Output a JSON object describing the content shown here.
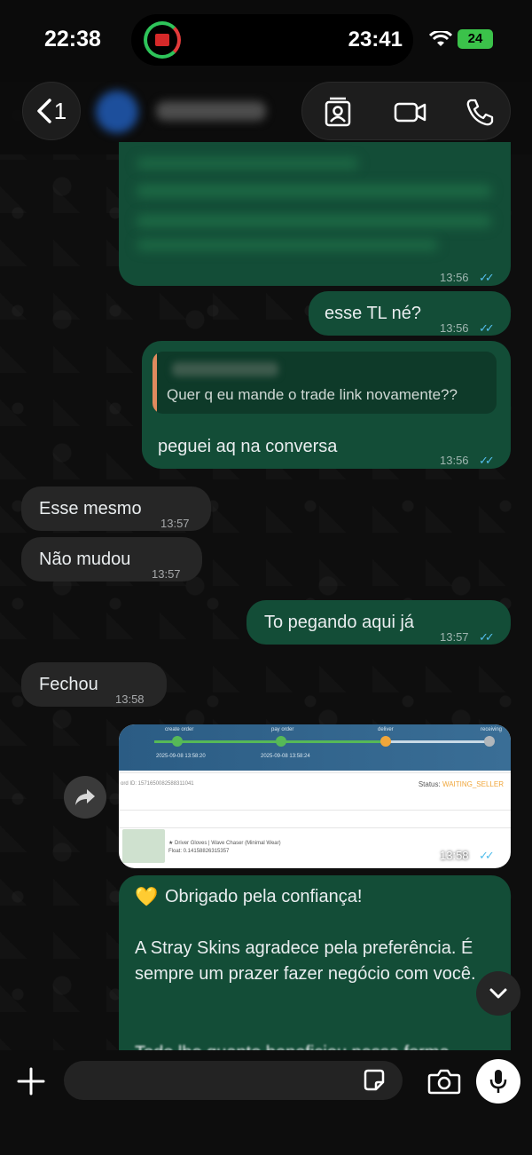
{
  "status_bar": {
    "time_left": "22:38",
    "island_time": "23:41",
    "battery": "24"
  },
  "header": {
    "back_count": "1",
    "icons": [
      "contact-card-icon",
      "video-call-icon",
      "phone-icon"
    ]
  },
  "messages": {
    "m1": {
      "time": "13:56"
    },
    "m2": {
      "text": "esse TL né?",
      "time": "13:56"
    },
    "m3": {
      "quote": "Quer q eu mande o trade link novamente??",
      "text": "peguei aq na conversa",
      "time": "13:56"
    },
    "m4": {
      "text": "Esse mesmo",
      "time": "13:57"
    },
    "m5": {
      "text": "Não mudou",
      "time": "13:57"
    },
    "m6": {
      "text": "To pegando aqui já",
      "time": "13:57"
    },
    "m7": {
      "text": "Fechou",
      "time": "13:58"
    },
    "m8": {
      "time": "13:58",
      "screenshot": {
        "steps": [
          "create order",
          "pay order",
          "deliver",
          "receiving"
        ],
        "dates": [
          "2025-09-08 13:58:20",
          "2025-09-08 13:58:24"
        ],
        "order_id": "ord ID: 1571650082588311041",
        "status_label": "Status: ",
        "status_value": "WAITING_SELLER",
        "item_name": "★ Driver Gloves | Wave Chaser (Minimal Wear)",
        "item_float": "Float: 0.14158826315357"
      }
    },
    "m9": {
      "heart": "💛",
      "line1": "Obrigado pela confiança!",
      "line2": "A Stray Skins agradece pela preferência. É sempre um prazer fazer negócio com você.",
      "line3": "Todo lhe quanto beneficiou nessa forma"
    }
  },
  "colors": {
    "outgoing_bubble": "#134d37",
    "incoming_bubble": "#262626",
    "read_ticks": "#53bdeb",
    "quote_bar": "#e08a5e"
  }
}
